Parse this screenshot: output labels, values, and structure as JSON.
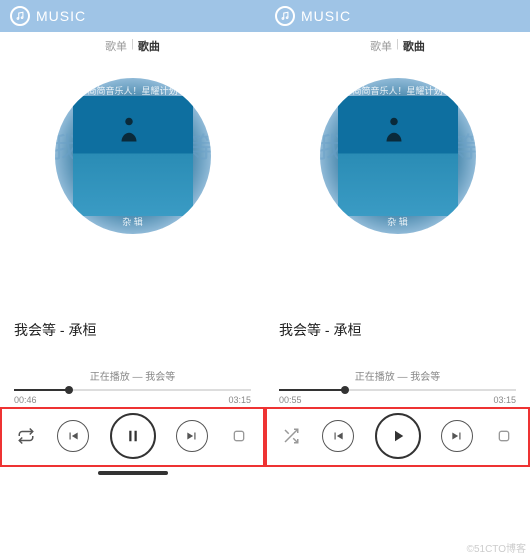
{
  "brand": "MUSIC",
  "tabs": {
    "playlist": "歌单",
    "song": "歌曲",
    "sep": "|"
  },
  "art": {
    "banner": "简简音乐人！星耀计划",
    "label": "杂 辑"
  },
  "side": {
    "left": "我",
    "right": "等"
  },
  "track": {
    "title": "我会等 - 承桓"
  },
  "nowplaying": {
    "prefix": "正在播放 — ",
    "song": "我会等"
  },
  "left": {
    "cur": "00:46",
    "dur": "03:15",
    "pct": 23,
    "playing": true
  },
  "right": {
    "cur": "00:55",
    "dur": "03:15",
    "pct": 28,
    "playing": false
  },
  "watermark": "©51CTO博客"
}
